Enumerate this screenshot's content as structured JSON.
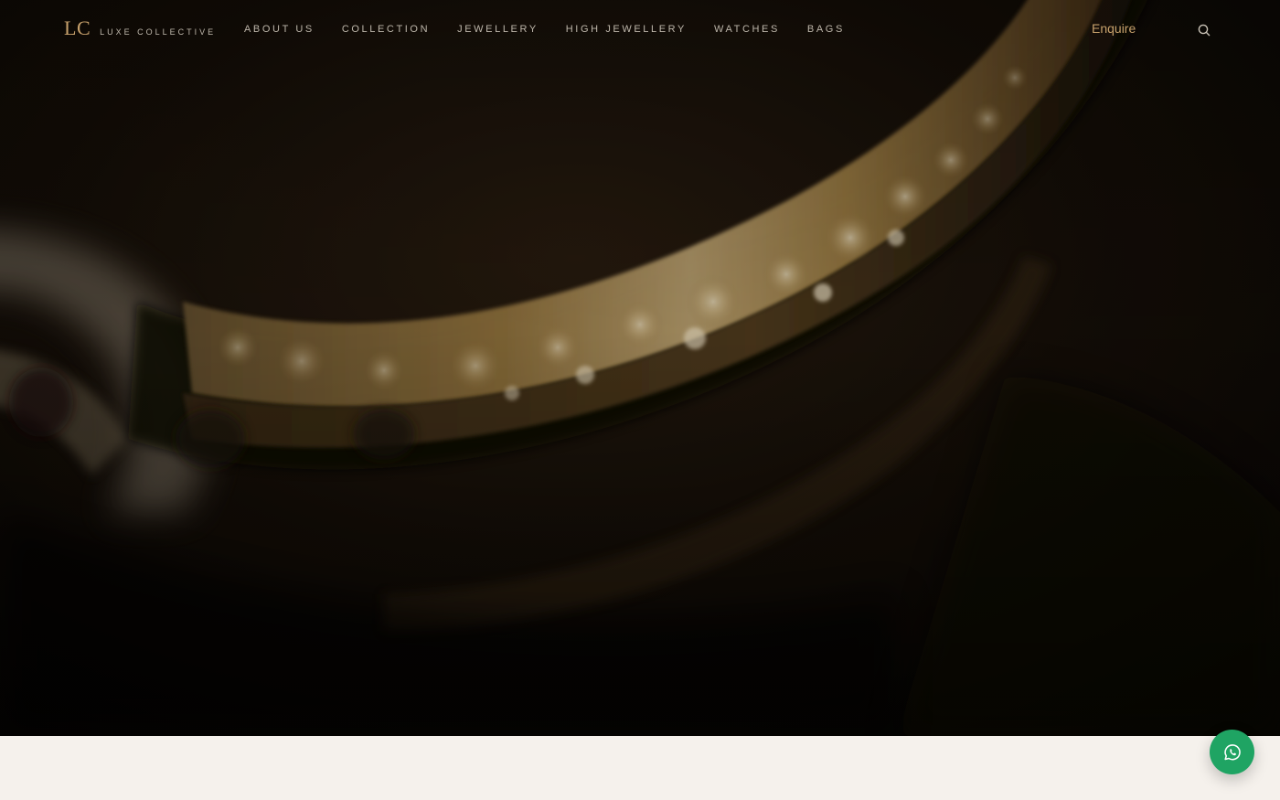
{
  "brand": {
    "mark": "LC",
    "name": "LUXE COLLECTIVE"
  },
  "nav": {
    "items": [
      {
        "label": "ABOUT US"
      },
      {
        "label": "COLLECTION"
      },
      {
        "label": "JEWELLERY"
      },
      {
        "label": "HIGH JEWELLERY"
      },
      {
        "label": "WATCHES"
      },
      {
        "label": "BAGS"
      }
    ]
  },
  "header": {
    "enquire_label": "Enquire",
    "search_icon": "search-icon"
  },
  "fab": {
    "icon": "whatsapp-icon",
    "color": "#1fa463"
  },
  "colors": {
    "accent_gold": "#c6a06b",
    "nav_text": "#bdb6aa",
    "hero_dark": "#0d0a07",
    "section_cream": "#f5f1ec"
  }
}
